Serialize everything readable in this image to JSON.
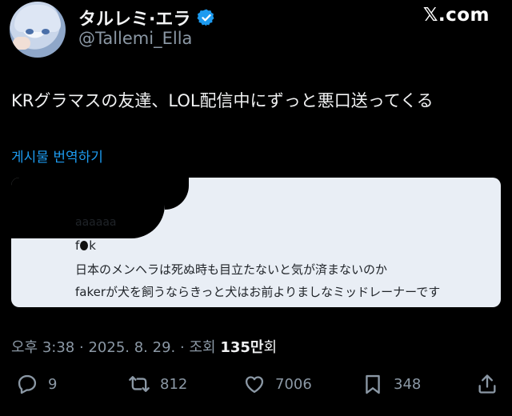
{
  "author": {
    "display_name": "タルレミ·エラ",
    "handle": "@Tallemi_Ella"
  },
  "brand": {
    "logo_text": "𝕏.com"
  },
  "tweet": {
    "text": "KRグラマスの友達、LOL配信中にずっと悪口送ってくる",
    "translate_label": "게시물 번역하기"
  },
  "attached_screenshot": {
    "line1": "aaaaaa",
    "line2_before": "f",
    "line2_after": "k",
    "line3": "日本のメンヘラは死ぬ時も目立たないと気が済まないのか",
    "line4": "fakerが犬を飼うならきっと犬はお前よりましなミッドレーナーです"
  },
  "meta": {
    "time": "오후 3:38",
    "separator": "·",
    "date": "2025. 8. 29.",
    "views_label": "조회",
    "views_count": "135만",
    "views_unit": "회"
  },
  "actions": {
    "replies": "9",
    "reposts": "812",
    "likes": "7006",
    "bookmarks": "348"
  },
  "colors": {
    "background": "#000000",
    "link": "#1d9bf0",
    "muted": "#8b98a5",
    "verified": "#1d9bf0"
  },
  "icons": {
    "verified": "verified-badge-icon",
    "reply": "reply-icon",
    "repost": "repost-icon",
    "like": "heart-icon",
    "bookmark": "bookmark-icon",
    "share": "share-icon"
  }
}
